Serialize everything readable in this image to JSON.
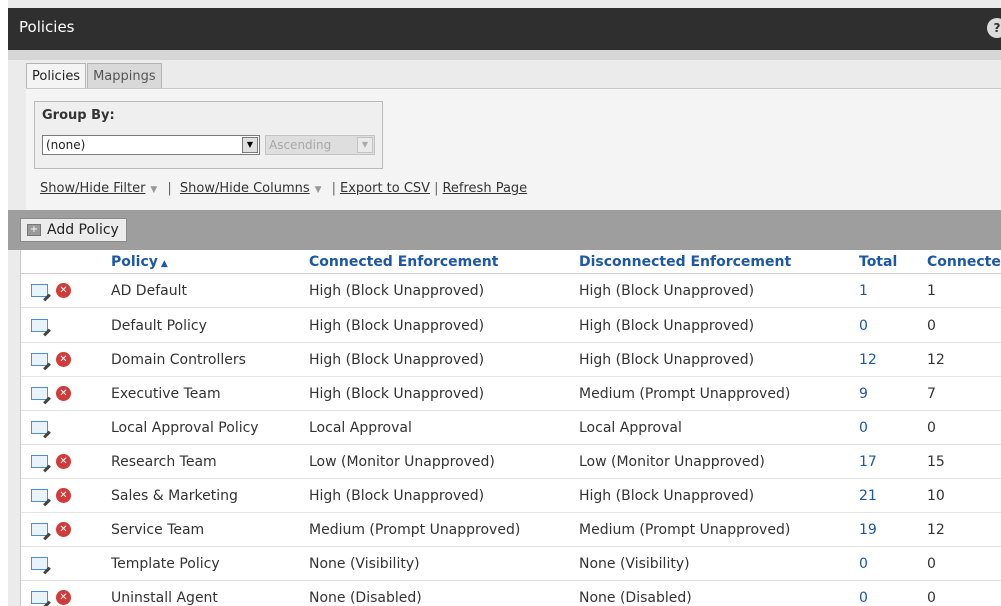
{
  "window": {
    "title": "Policies",
    "help_icon": "help-icon",
    "help_glyph": "?"
  },
  "tabs": [
    {
      "label": "Policies",
      "active": true
    },
    {
      "label": "Mappings",
      "active": false
    }
  ],
  "group_by": {
    "label": "Group By:",
    "selected": "(none)",
    "order_selected": "Ascending",
    "order_disabled": true
  },
  "actions": {
    "show_hide_filter": "Show/Hide Filter",
    "show_hide_columns": "Show/Hide Columns",
    "export_csv": "Export to CSV",
    "refresh_page": "Refresh Page",
    "separator": "|"
  },
  "toolbar": {
    "add_policy": "Add Policy"
  },
  "table": {
    "columns": [
      "Policy",
      "Connected Enforcement",
      "Disconnected Enforcement",
      "Total",
      "Connected"
    ],
    "sort_column": "Policy",
    "sort_glyph": "▲",
    "rows": [
      {
        "policy": "AD Default",
        "connected_enforcement": "High (Block Unapproved)",
        "disconnected_enforcement": "High (Block Unapproved)",
        "total": "1",
        "connected": "1",
        "deletable": true
      },
      {
        "policy": "Default Policy",
        "connected_enforcement": "High (Block Unapproved)",
        "disconnected_enforcement": "High (Block Unapproved)",
        "total": "0",
        "connected": "0",
        "deletable": false
      },
      {
        "policy": "Domain Controllers",
        "connected_enforcement": "High (Block Unapproved)",
        "disconnected_enforcement": "High (Block Unapproved)",
        "total": "12",
        "connected": "12",
        "deletable": true
      },
      {
        "policy": "Executive Team",
        "connected_enforcement": "High (Block Unapproved)",
        "disconnected_enforcement": "Medium (Prompt Unapproved)",
        "total": "9",
        "connected": "7",
        "deletable": true
      },
      {
        "policy": "Local Approval Policy",
        "connected_enforcement": "Local Approval",
        "disconnected_enforcement": "Local Approval",
        "total": "0",
        "connected": "0",
        "deletable": false
      },
      {
        "policy": "Research Team",
        "connected_enforcement": "Low (Monitor Unapproved)",
        "disconnected_enforcement": "Low (Monitor Unapproved)",
        "total": "17",
        "connected": "15",
        "deletable": true
      },
      {
        "policy": "Sales & Marketing",
        "connected_enforcement": "High (Block Unapproved)",
        "disconnected_enforcement": "High (Block Unapproved)",
        "total": "21",
        "connected": "10",
        "deletable": true
      },
      {
        "policy": "Service Team",
        "connected_enforcement": "Medium (Prompt Unapproved)",
        "disconnected_enforcement": "Medium (Prompt Unapproved)",
        "total": "19",
        "connected": "12",
        "deletable": true
      },
      {
        "policy": "Template Policy",
        "connected_enforcement": "None (Visibility)",
        "disconnected_enforcement": "None (Visibility)",
        "total": "0",
        "connected": "0",
        "deletable": false
      },
      {
        "policy": "Uninstall Agent",
        "connected_enforcement": "None (Disabled)",
        "disconnected_enforcement": "None (Disabled)",
        "total": "0",
        "connected": "0",
        "deletable": true
      }
    ]
  },
  "colors": {
    "link": "#1d57a8",
    "titlebar": "#2f2f2f",
    "delete": "#d23a3a"
  }
}
